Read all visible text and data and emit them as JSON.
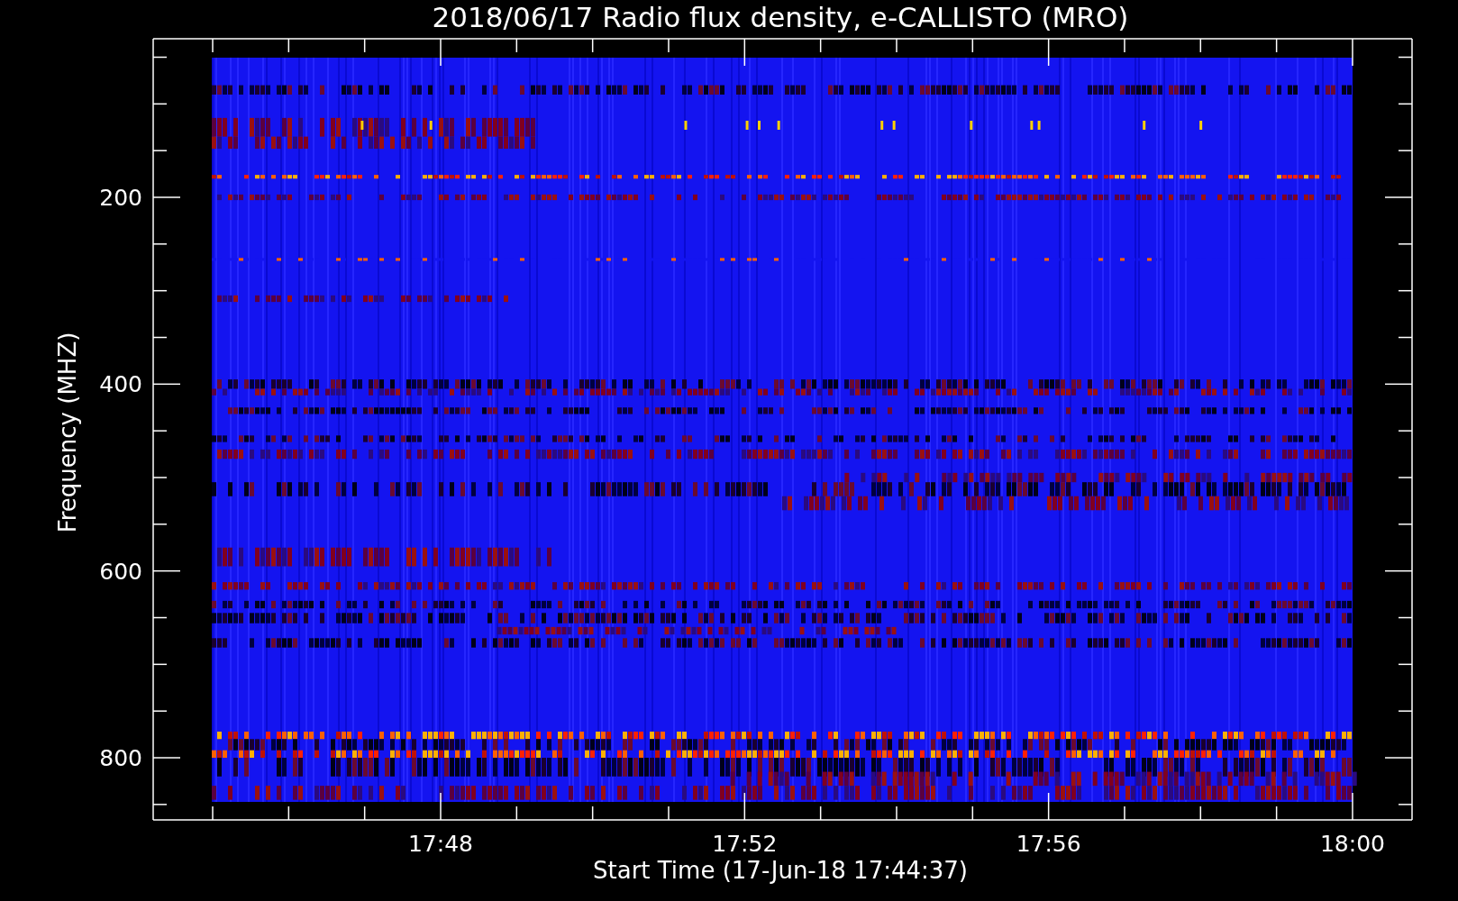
{
  "title": "2018/06/17  Radio flux density, e-CALLISTO (MRO)",
  "x_axis": {
    "label": "Start Time (17-Jun-18 17:44:37)",
    "ticks": [
      "17:48",
      "17:52",
      "17:56",
      "18:00"
    ]
  },
  "y_axis": {
    "label": "Frequency (MHZ)",
    "ticks": [
      "200",
      "400",
      "600",
      "800"
    ]
  }
}
